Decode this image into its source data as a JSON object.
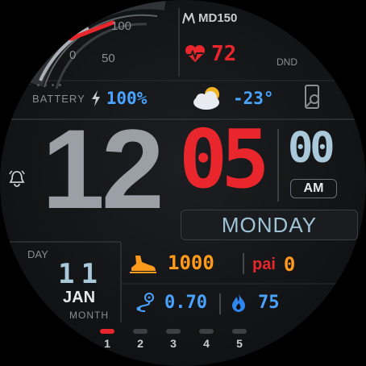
{
  "brand": {
    "logo_text": "MD150"
  },
  "heart_rate": {
    "value": "72",
    "icon": "heart-pulse-icon"
  },
  "dnd": {
    "label": "DND"
  },
  "gauge": {
    "tick_100": "100",
    "tick_50": "50",
    "tick_0": "0"
  },
  "battery": {
    "label": "BATTERY",
    "value": "100%",
    "icon": "lightning-icon"
  },
  "weather": {
    "temp": "-23°",
    "icon": "cloudy-sun-icon"
  },
  "phone": {
    "icon": "phone-settings-icon"
  },
  "time": {
    "hours": "12",
    "minutes": "05",
    "seconds": "00",
    "ampm": "AM"
  },
  "alarm": {
    "icon": "alarm-bell-icon"
  },
  "weekday": {
    "value": "MONDAY"
  },
  "date": {
    "day_label": "DAY",
    "day": "11",
    "month": "JAN",
    "month_label": "MONTH"
  },
  "steps": {
    "value": "1000",
    "icon": "shoe-icon"
  },
  "pai": {
    "label": "pai",
    "value": "0"
  },
  "distance": {
    "value": "0.70",
    "icon": "route-icon"
  },
  "calories": {
    "value": "75",
    "icon": "flame-icon"
  },
  "pages": {
    "items": [
      "1",
      "2",
      "3",
      "4",
      "5"
    ],
    "active": 0
  },
  "colors": {
    "accent_red": "#e8262b",
    "accent_blue": "#4aa3ff",
    "accent_orange": "#ff9a1a",
    "digit_grey": "#9aa0a6"
  }
}
